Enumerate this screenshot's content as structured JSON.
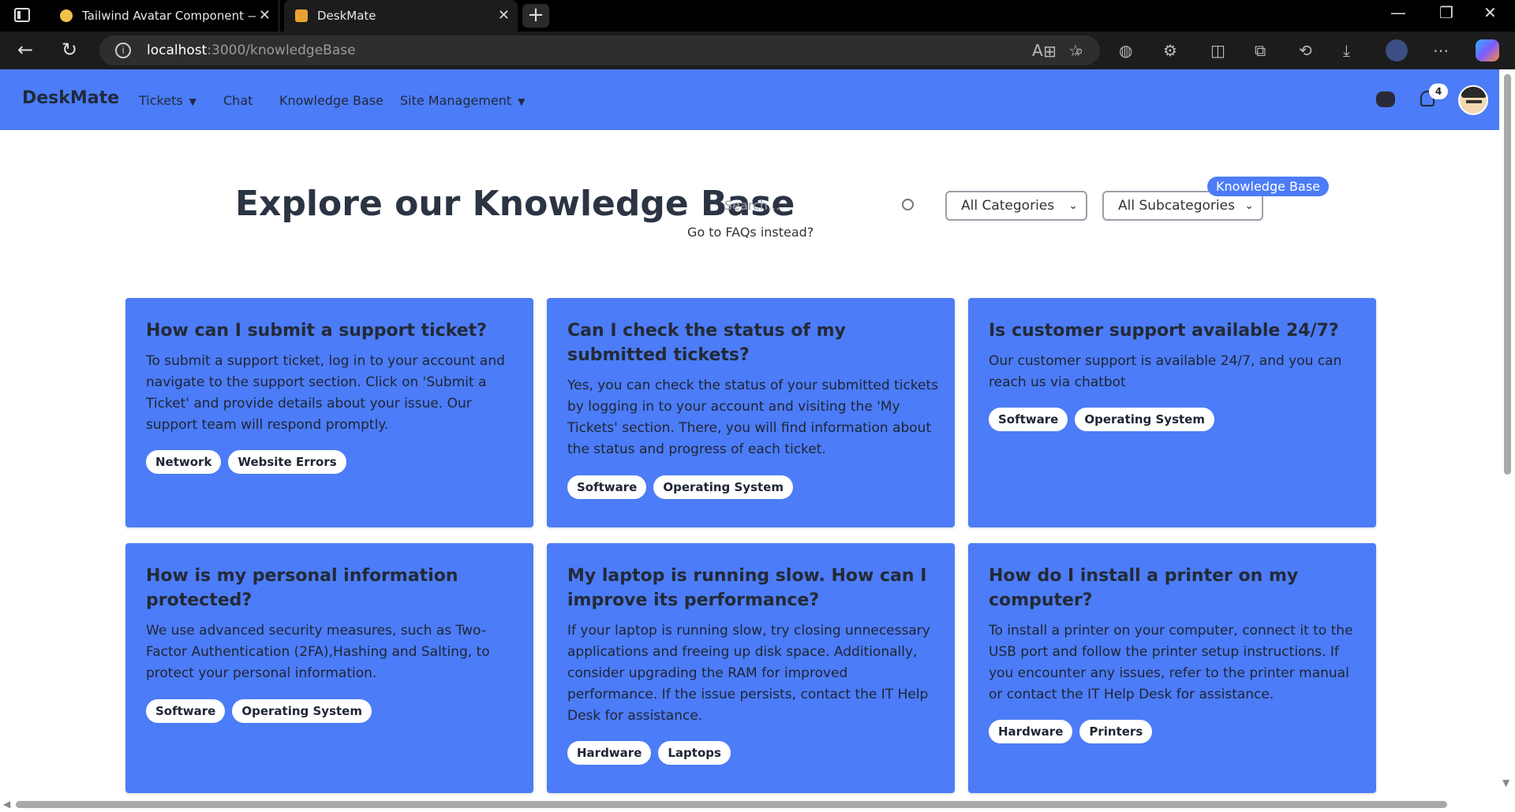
{
  "browser": {
    "tabs": [
      {
        "title": "Tailwind Avatar Component — Ta"
      },
      {
        "title": "DeskMate"
      }
    ],
    "url_host": "localhost",
    "url_path": ":3000/knowledgeBase"
  },
  "nav": {
    "brand": "DeskMate",
    "links": [
      "Tickets",
      "Chat",
      "Knowledge Base",
      "Site Management"
    ],
    "notification_count": "4"
  },
  "hero": {
    "title": "Explore our Knowledge Base",
    "search_placeholder": "Search...",
    "faq_link": "Go to FAQs instead?",
    "category_select": "All Categories",
    "subcategory_select": "All Subcategories",
    "pill": "Knowledge Base"
  },
  "cards": [
    {
      "question": "How can I submit a support ticket?",
      "answer": "To submit a support ticket, log in to your account and navigate to the support section. Click on 'Submit a Ticket' and provide details about your issue. Our support team will respond promptly.",
      "tags": [
        "Network",
        "Website Errors"
      ]
    },
    {
      "question": "Can I check the status of my submitted tickets?",
      "answer": "Yes, you can check the status of your submitted tickets by logging in to your account and visiting the 'My Tickets' section. There, you will find information about the status and progress of each ticket.",
      "tags": [
        "Software",
        "Operating System"
      ]
    },
    {
      "question": "Is customer support available 24/7?",
      "answer": "Our customer support is available 24/7, and you can reach us via chatbot",
      "tags": [
        "Software",
        "Operating System"
      ]
    },
    {
      "question": "How is my personal information protected?",
      "answer": "We use advanced security measures, such as Two-Factor Authentication (2FA),Hashing and Salting, to protect your personal information.",
      "tags": [
        "Software",
        "Operating System"
      ]
    },
    {
      "question": "My laptop is running slow. How can I improve its performance?",
      "answer": "If your laptop is running slow, try closing unnecessary applications and freeing up disk space. Additionally, consider upgrading the RAM for improved performance. If the issue persists, contact the IT Help Desk for assistance.",
      "tags": [
        "Hardware",
        "Laptops"
      ]
    },
    {
      "question": "How do I install a printer on my computer?",
      "answer": "To install a printer on your computer, connect it to the USB port and follow the printer setup instructions. If you encounter any issues, refer to the printer manual or contact the IT Help Desk for assistance.",
      "tags": [
        "Hardware",
        "Printers"
      ]
    }
  ]
}
